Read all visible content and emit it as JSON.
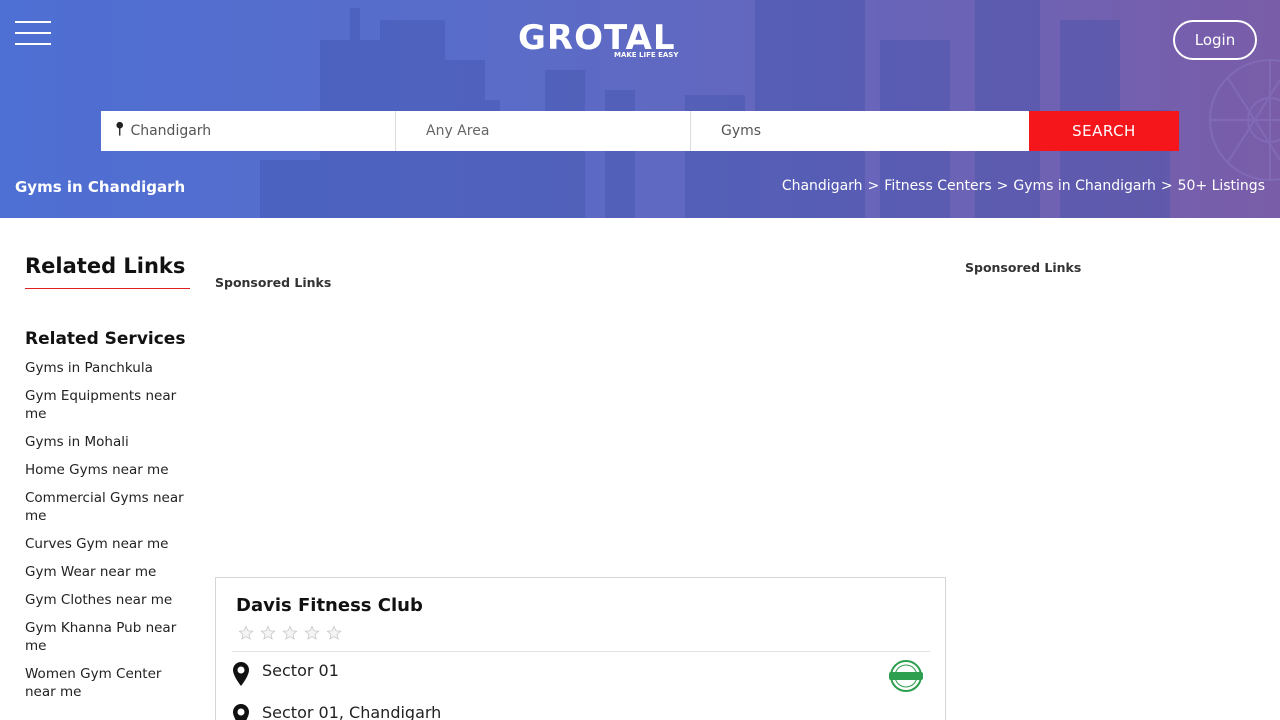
{
  "header": {
    "logo_text": "GROTAL",
    "logo_tagline": "MAKE LIFE EASY",
    "login_label": "Login",
    "page_heading": "Gyms in Chandigarh"
  },
  "search": {
    "city_value": "Chandigarh",
    "area_placeholder": "Any Area",
    "category_value": "Gyms",
    "button_label": "SEARCH"
  },
  "breadcrumb": {
    "items": [
      "Chandigarh",
      "Fitness Centers",
      "Gyms in Chandigarh"
    ],
    "separator": ">",
    "count": "50+ Listings"
  },
  "sidebar": {
    "title": "Related Links",
    "section_title": "Related Services",
    "items": [
      "Gyms in Panchkula",
      "Gym Equipments near me",
      "Gyms in Mohali",
      "Home Gyms near me",
      "Commercial Gyms near me",
      "Curves Gym near me",
      "Gym Wear near me",
      "Gym Clothes near me",
      "Gym Khanna Pub near me",
      "Women Gym Center near me"
    ]
  },
  "sponsored": {
    "center_label": "Sponsored Links",
    "right_label": "Sponsored Links"
  },
  "listing": {
    "name": "Davis Fitness Club",
    "rating": 0,
    "max_rating": 5,
    "area": "Sector 01",
    "address": "Sector 01, Chandigarh",
    "verified_icon": "verified-badge-icon"
  },
  "colors": {
    "accent_red": "#f5161c",
    "hero_start": "#4e6fd4",
    "hero_end": "#7a5da8",
    "verified_green": "#2e9e4f"
  }
}
